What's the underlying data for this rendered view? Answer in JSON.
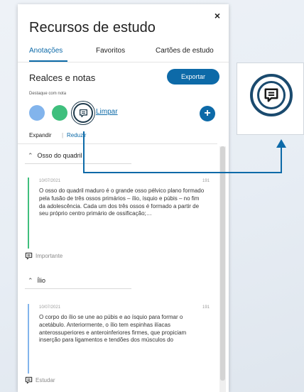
{
  "panel": {
    "title": "Recursos de estudo",
    "close_label": "×",
    "tabs": [
      {
        "label": "Anotações",
        "active": true
      },
      {
        "label": "Favoritos",
        "active": false
      },
      {
        "label": "Cartões de estudo",
        "active": false
      }
    ],
    "section_title": "Realces e notas",
    "export_label": "Exportar",
    "highlight_label": "Destaque com nota",
    "clear_label": "Limpar",
    "add_label": "+",
    "expand_label": "Expandir",
    "separator": "|",
    "collapse_label": "Reduzir",
    "groups": [
      {
        "title": "Osso do quadril",
        "notes": [
          {
            "date": "10/07/2021",
            "page": "191",
            "text": "O osso do quadril maduro é o grande osso pélvico plano formado pela fusão de três ossos primários – ílio, ísquio e púbis – no fim da adolescência. Cada um dos três ossos é formado a partir de seu próprio centro primário de ossificação;…",
            "tag": "Importante",
            "bar_color": "#3fbf7d"
          }
        ]
      },
      {
        "title": "Ílio",
        "notes": [
          {
            "date": "10/07/2021",
            "page": "191",
            "text": "O corpo do ílio se une ao púbis e ao ísquio para formar o acetábulo. Anteriormente, o ílio tem espinhas ilíacas anterossuperiores e anteroinferiores firmes, que propiciam inserção para ligamentos e tendões dos músculos do",
            "tag": "Estudar",
            "bar_color": "#82b4ec"
          }
        ]
      }
    ]
  },
  "colors": {
    "accent": "#0d6aa8",
    "swatch_blue": "#82b4ec",
    "swatch_green": "#3fbf7d",
    "icon_dark": "#1f3b4d"
  },
  "icons": {
    "note": "speech-bubble-lines-icon",
    "add": "plus-icon",
    "close": "close-icon",
    "chevron": "chevron-up-icon"
  }
}
